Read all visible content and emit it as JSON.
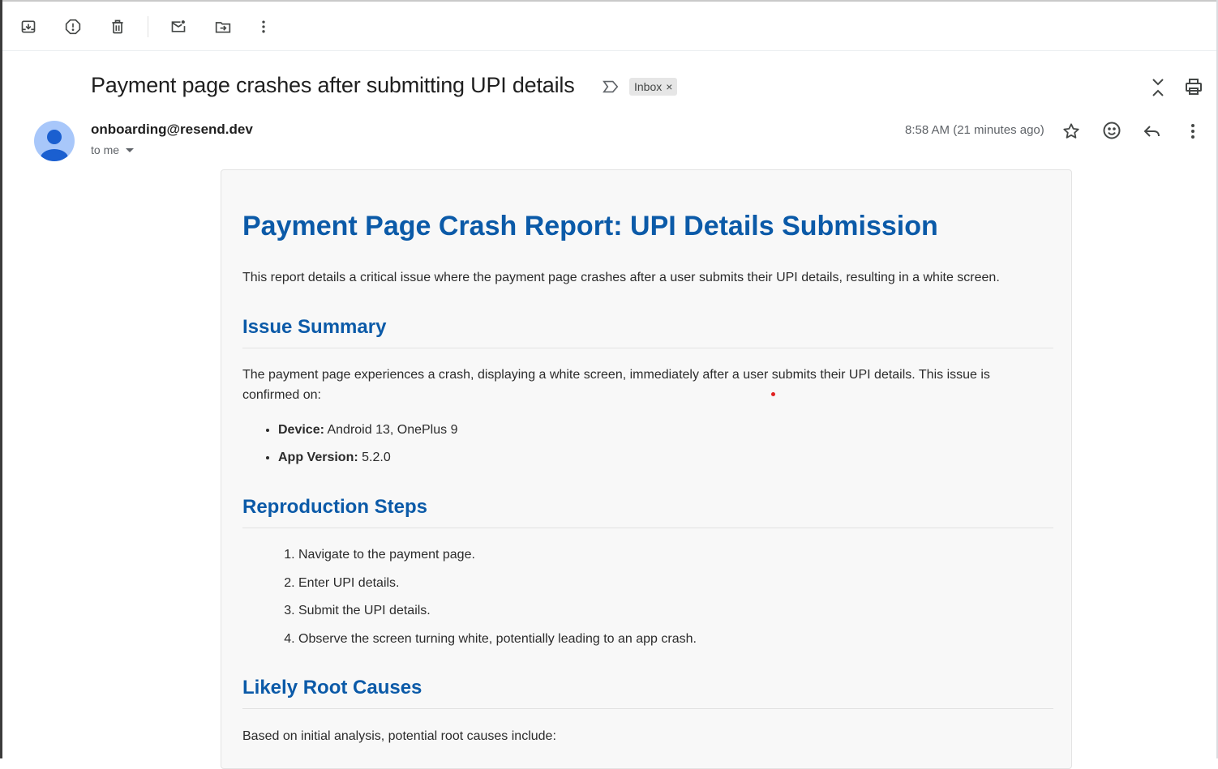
{
  "toolbar": {
    "icons": [
      "archive-icon",
      "report-spam-icon",
      "delete-icon",
      "mark-unread-icon",
      "move-to-icon",
      "more-vert-icon"
    ]
  },
  "subject": {
    "text": "Payment page crashes after submitting UPI details",
    "label": "Inbox",
    "label_remove": "×"
  },
  "message": {
    "sender": "onboarding@resend.dev",
    "recipient": "to me",
    "time": "8:58 AM (21 minutes ago)"
  },
  "body": {
    "title": "Payment Page Crash Report: UPI Details Submission",
    "intro": "This report details a critical issue where the payment page crashes after a user submits their UPI details, resulting in a white screen.",
    "issue_summary": {
      "heading": "Issue Summary",
      "text": "The payment page experiences a crash, displaying a white screen, immediately after a user submits their UPI details. This issue is confirmed on:",
      "items": [
        {
          "label": "Device:",
          "value": " Android 13, OnePlus 9"
        },
        {
          "label": "App Version:",
          "value": " 5.2.0"
        }
      ]
    },
    "reproduction": {
      "heading": "Reproduction Steps",
      "steps": [
        "Navigate to the payment page.",
        "Enter UPI details.",
        "Submit the UPI details.",
        "Observe the screen turning white, potentially leading to an app crash."
      ]
    },
    "root_causes": {
      "heading": "Likely Root Causes",
      "text": "Based on initial analysis, potential root causes include:"
    }
  },
  "colors": {
    "heading": "#0b5aa8",
    "avatar": "#a8c7fa",
    "avatar_figure": "#1a5fd0"
  }
}
